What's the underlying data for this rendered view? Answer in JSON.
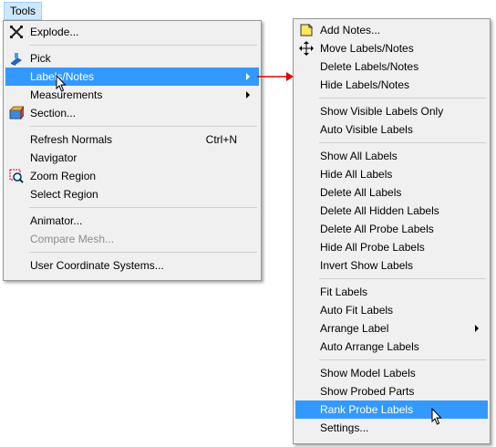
{
  "menubar": {
    "tools_label": "Tools"
  },
  "tools_menu": {
    "items": [
      {
        "label": "Explode..."
      },
      {
        "label": "Pick"
      },
      {
        "label": "Labels/Notes"
      },
      {
        "label": "Measurements"
      },
      {
        "label": "Section..."
      },
      {
        "label": "Refresh Normals",
        "shortcut": "Ctrl+N"
      },
      {
        "label": "Navigator"
      },
      {
        "label": "Zoom Region"
      },
      {
        "label": "Select Region"
      },
      {
        "label": "Animator..."
      },
      {
        "label": "Compare Mesh..."
      },
      {
        "label": "User Coordinate Systems..."
      }
    ]
  },
  "labels_menu": {
    "items": [
      {
        "label": "Add Notes..."
      },
      {
        "label": "Move Labels/Notes"
      },
      {
        "label": "Delete Labels/Notes"
      },
      {
        "label": "Hide Labels/Notes"
      },
      {
        "label": "Show Visible Labels Only"
      },
      {
        "label": "Auto Visible Labels"
      },
      {
        "label": "Show All Labels"
      },
      {
        "label": "Hide All Labels"
      },
      {
        "label": "Delete All Labels"
      },
      {
        "label": "Delete All Hidden Labels"
      },
      {
        "label": "Delete All Probe Labels"
      },
      {
        "label": "Hide All Probe Labels"
      },
      {
        "label": "Invert Show Labels"
      },
      {
        "label": "Fit Labels"
      },
      {
        "label": "Auto Fit Labels"
      },
      {
        "label": "Arrange Label"
      },
      {
        "label": "Auto Arrange Labels"
      },
      {
        "label": "Show Model Labels"
      },
      {
        "label": "Show Probed Parts"
      },
      {
        "label": "Rank Probe Labels"
      },
      {
        "label": "Settings..."
      }
    ]
  },
  "icons": {
    "explode": "explode-icon",
    "pick": "pick-icon",
    "section": "section-icon",
    "zoom_region": "zoom-region-icon",
    "add_notes": "note-icon",
    "move_labels": "move-icon",
    "cursor": "mouse-pointer-icon",
    "callout": "red-arrow-icon"
  },
  "colors": {
    "highlight": "#3399ff",
    "menubar_highlight": "#cce8ff",
    "menu_background": "#f0f0f0",
    "disabled_text": "#8c8c8c",
    "callout_arrow": "#e00000"
  }
}
